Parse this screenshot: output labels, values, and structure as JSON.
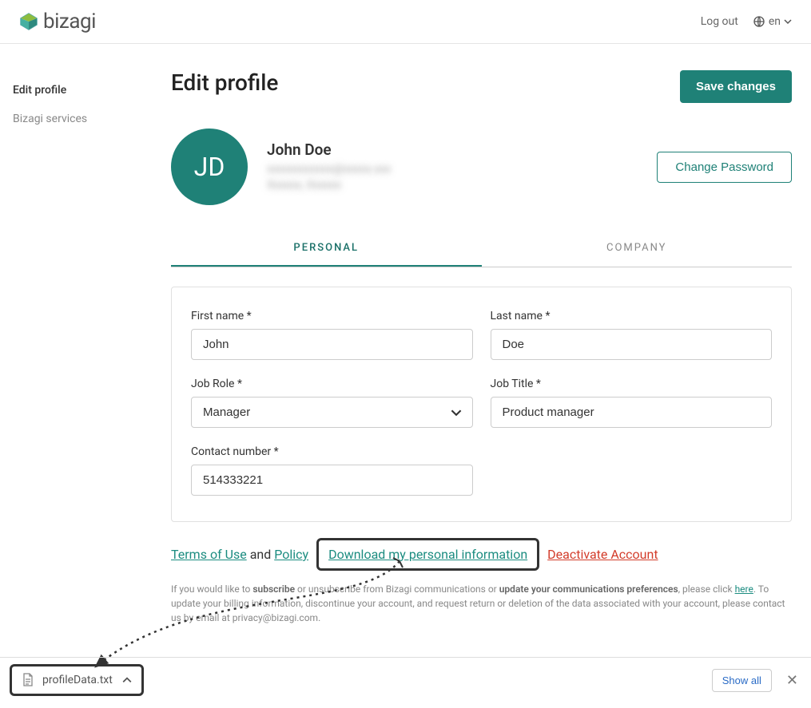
{
  "header": {
    "logo_text": "bizagi",
    "logout": "Log out",
    "lang": "en"
  },
  "sidebar": {
    "items": [
      {
        "label": "Edit profile",
        "active": true
      },
      {
        "label": "Bizagi services",
        "active": false
      }
    ]
  },
  "page": {
    "title": "Edit profile",
    "save_btn": "Save changes",
    "change_pw_btn": "Change Password"
  },
  "profile": {
    "initials": "JD",
    "name": "John Doe"
  },
  "tabs": {
    "personal": "PERSONAL",
    "company": "COMPANY"
  },
  "form": {
    "first_name_label": "First name *",
    "first_name_value": "John",
    "last_name_label": "Last name *",
    "last_name_value": "Doe",
    "job_role_label": "Job Role *",
    "job_role_value": "Manager",
    "job_title_label": "Job Title *",
    "job_title_value": "Product manager",
    "contact_label": "Contact number *",
    "contact_value": "514333221"
  },
  "links": {
    "terms": "Terms of Use",
    "and": "and",
    "policy": "Policy",
    "download_info": "Download my personal information",
    "deactivate": "Deactivate Account"
  },
  "footer": {
    "t1": "If you would like to ",
    "b1": "subscribe",
    "t2": " or unsubscribe from Bizagi communications or ",
    "b2": "update your communications preferences",
    "t3": ", please click ",
    "here": "here",
    "t4": ". To update your billing information, discontinue your account, and request return or deletion of the data associated with your account, please contact us by email at privacy@bizagi.com."
  },
  "download_bar": {
    "filename": "profileData.txt",
    "show_all": "Show all"
  }
}
